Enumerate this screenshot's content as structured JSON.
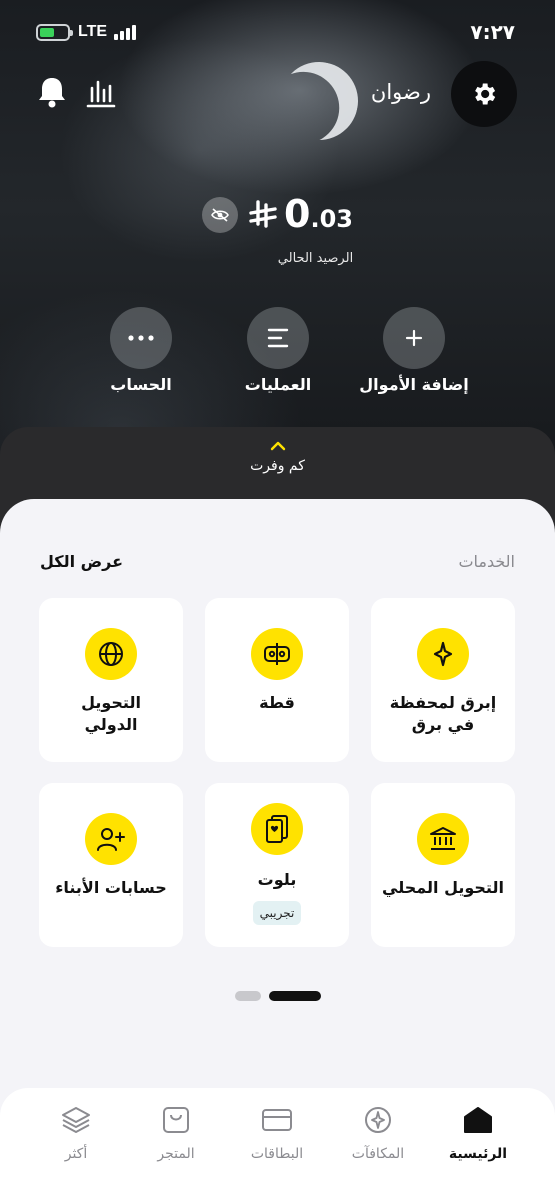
{
  "status_bar": {
    "time": "٧:٢٧",
    "network": "LTE"
  },
  "header": {
    "username": "رضوان"
  },
  "balance": {
    "amount_int": "0",
    "amount_dec": ".03",
    "label": "الرصيد الحالي"
  },
  "actions": [
    {
      "label": "إضافة الأموال",
      "icon": "plus-icon"
    },
    {
      "label": "العمليات",
      "icon": "list-icon"
    },
    {
      "label": "الحساب",
      "icon": "more-icon"
    }
  ],
  "savings": {
    "label": "كم وفرت"
  },
  "services": {
    "title": "الخدمات",
    "view_all": "عرض الكل",
    "tiles": [
      {
        "label_line1": "إبرق لمحفظة",
        "label_line2": "في برق",
        "icon": "sparkle-icon"
      },
      {
        "label_line1": "قطة",
        "label_line2": "",
        "icon": "split-icon"
      },
      {
        "label_line1": "التحويل",
        "label_line2": "الدولي",
        "icon": "globe-icon"
      },
      {
        "label_line1": "التحويل المحلي",
        "label_line2": "",
        "icon": "bank-icon"
      },
      {
        "label_line1": "بلوت",
        "label_line2": "",
        "badge": "تجريبي",
        "icon": "cards-icon"
      },
      {
        "label_line1": "حسابات الأبناء",
        "label_line2": "",
        "icon": "add-user-icon"
      }
    ],
    "pager": {
      "pages": 2,
      "active": 1
    }
  },
  "bottom_nav": [
    {
      "label": "الرئيسية",
      "icon": "home-icon",
      "active": true
    },
    {
      "label": "المكافآت",
      "icon": "rewards-icon",
      "active": false
    },
    {
      "label": "البطاقات",
      "icon": "card-icon",
      "active": false
    },
    {
      "label": "المتجر",
      "icon": "store-icon",
      "active": false
    },
    {
      "label": "أكثر",
      "icon": "layers-icon",
      "active": false
    }
  ],
  "colors": {
    "accent": "#FFE200",
    "dark": "#0D0E10",
    "background": "#F4F4F8"
  }
}
